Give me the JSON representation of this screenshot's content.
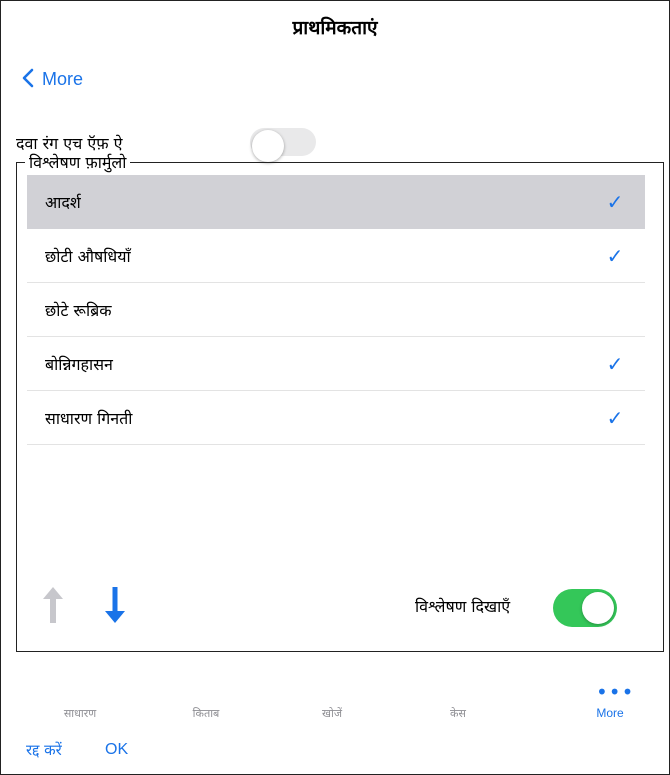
{
  "header": {
    "title": "प्राथमिकताएं",
    "back_label": "More"
  },
  "drug_color": {
    "label": "दवा रंग एच ऍफ़ ऐ",
    "enabled": false
  },
  "formula_group": {
    "legend": "विश्लेषण फ़ार्मुलो",
    "items": [
      {
        "label": "आदर्श",
        "check": "✓"
      },
      {
        "label": "छोटी औषधियाँ",
        "check": "✓"
      },
      {
        "label": "छोटे रूब्रिक",
        "check": ""
      },
      {
        "label": "बोन्निगहासन",
        "check": "✓"
      },
      {
        "label": "साधारण गिनती",
        "check": "✓"
      }
    ],
    "show_analysis_label": "विश्लेषण दिखाएँ",
    "show_analysis_enabled": true
  },
  "tabbar": {
    "tabs": [
      "साधारण",
      "किताब",
      "खोजें",
      "केस",
      "More"
    ],
    "more_icon": "ellipsis-icon"
  },
  "footer": {
    "cancel_label": "रद्द करें",
    "ok_label": "OK"
  },
  "colors": {
    "accent": "#1a73e8",
    "toggle_on": "#34c759",
    "selected_row": "#d1d1d6",
    "disabled_arrow": "#c7c7cc"
  }
}
